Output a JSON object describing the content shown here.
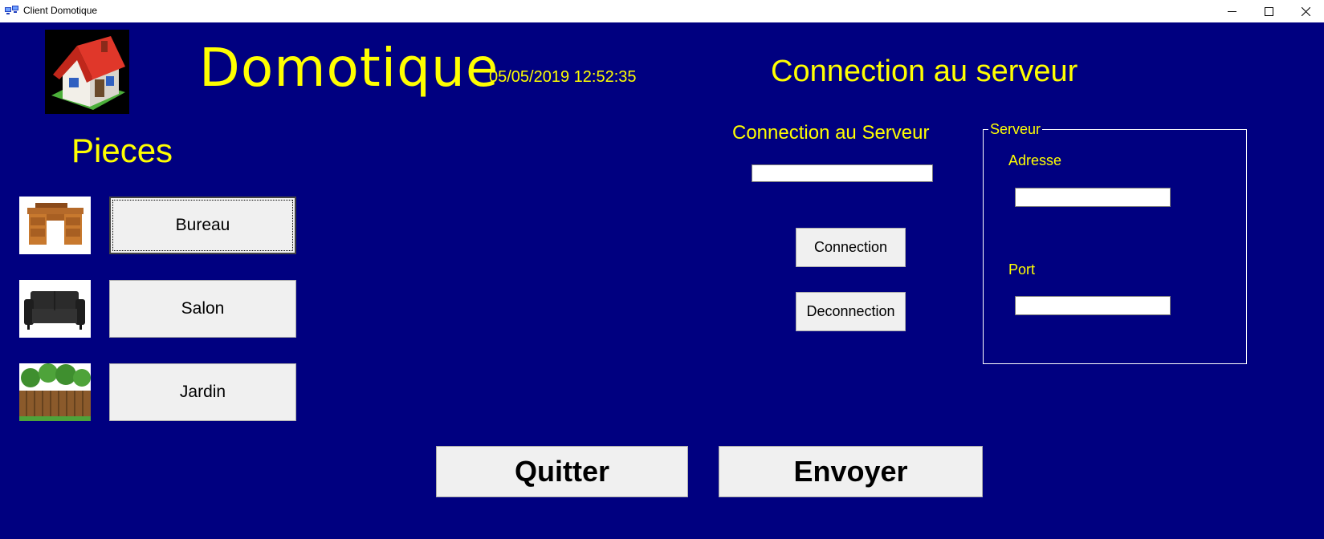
{
  "window": {
    "title": "Client Domotique",
    "icon": "network-app-icon",
    "controls": [
      "minimize-icon",
      "maximize-icon",
      "close-icon"
    ]
  },
  "header": {
    "title": "Domotique",
    "datetime": "05/05/2019 12:52:35",
    "server_heading": "Connection au serveur"
  },
  "rooms": {
    "label": "Pieces",
    "items": [
      {
        "label": "Bureau",
        "icon": "desk-icon"
      },
      {
        "label": "Salon",
        "icon": "sofa-icon"
      },
      {
        "label": "Jardin",
        "icon": "garden-fence-icon"
      }
    ]
  },
  "connection": {
    "label": "Connection au Serveur",
    "status_value": "",
    "connect_label": "Connection",
    "disconnect_label": "Deconnection"
  },
  "server": {
    "group_label": "Serveur",
    "address_label": "Adresse",
    "address_value": "",
    "port_label": "Port",
    "port_value": ""
  },
  "footer": {
    "quit_label": "Quitter",
    "send_label": "Envoyer"
  },
  "colors": {
    "background": "#000080",
    "text": "#ffff00",
    "button": "#f0f0f0"
  }
}
